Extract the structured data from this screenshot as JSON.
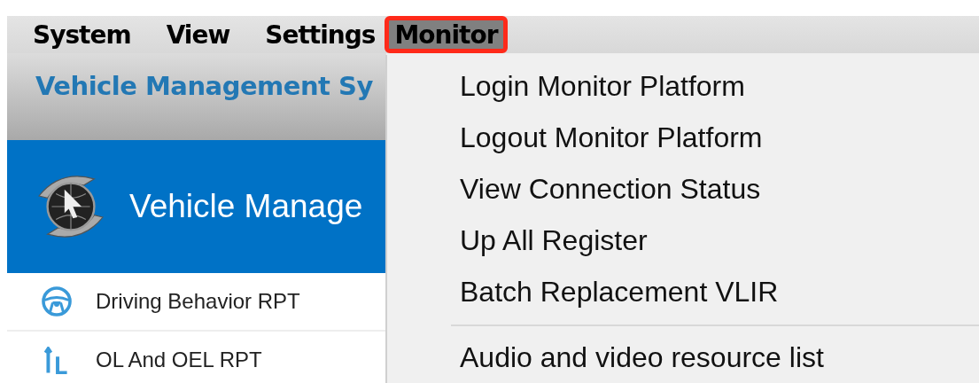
{
  "menubar": [
    {
      "label": "System",
      "selected": false
    },
    {
      "label": "View",
      "selected": false
    },
    {
      "label": "Settings",
      "selected": false
    },
    {
      "label": "Monitor",
      "selected": true
    }
  ],
  "header": {
    "title": "Vehicle Management Sy"
  },
  "banner": {
    "title": "Vehicle Manage"
  },
  "sidebar": {
    "items": [
      {
        "label": "Driving Behavior RPT",
        "kind": "wheel"
      },
      {
        "label": "OL And OEL RPT",
        "kind": "chart"
      }
    ]
  },
  "dropdown": {
    "items": [
      {
        "label": "Login Monitor Platform",
        "kind": "item"
      },
      {
        "label": "Logout Monitor Platform",
        "kind": "item"
      },
      {
        "label": "View Connection Status",
        "kind": "item"
      },
      {
        "label": "Up All Register",
        "kind": "item"
      },
      {
        "label": "Batch Replacement VLIR",
        "kind": "item"
      },
      {
        "kind": "separator"
      },
      {
        "label": "Audio and video resource list",
        "kind": "item"
      }
    ]
  }
}
